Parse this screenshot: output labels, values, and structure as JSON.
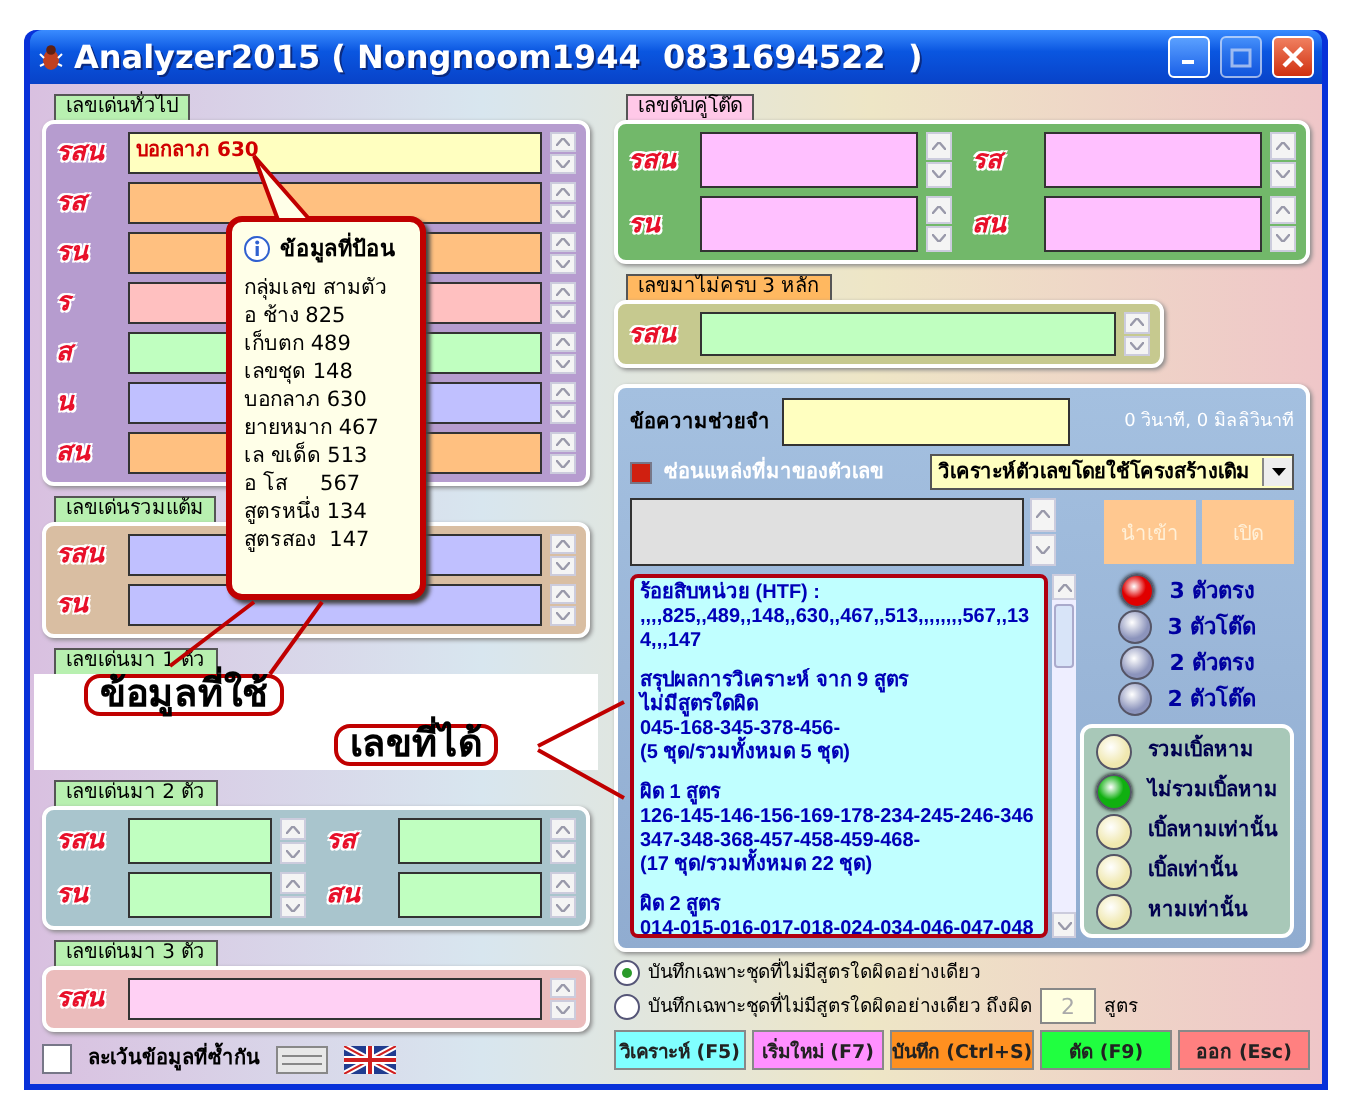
{
  "window": {
    "title": "Analyzer2015 ( Nongnoom1944  0831694522  )"
  },
  "left_groups": [
    {
      "tab": "เลขเด่นทั่วไป",
      "kind": "rows",
      "color": "#b69ccf",
      "rows": [
        {
          "label": "รสน",
          "value": "บอกลาภ 630",
          "color": "#ffffc0"
        },
        {
          "label": "รส",
          "color": "#ffc080"
        },
        {
          "label": "รน",
          "color": "#ffc080"
        },
        {
          "label": "ร",
          "color": "#ffc0c0"
        },
        {
          "label": "ส",
          "color": "#c0ffc0"
        },
        {
          "label": "น",
          "color": "#c0c0ff"
        },
        {
          "label": "สน",
          "color": "#ffc080"
        }
      ]
    },
    {
      "tab": "เลขเด่นรวมแต้ม",
      "kind": "rows",
      "color": "#d9bea2",
      "rows": [
        {
          "label": "รสน",
          "color": "#c0c0ff"
        },
        {
          "label": "รน",
          "color": "#c0c0ff"
        }
      ]
    },
    {
      "tab": "เลขเด่นมา 1 ตัว",
      "kind": "covered"
    },
    {
      "tab": "เลขเด่นมา 2 ตัว",
      "kind": "grid",
      "color": "#a9c5cd",
      "rows": [
        {
          "label": "รสน",
          "color": "#c0ffc0"
        },
        {
          "label": "รส",
          "color": "#c0ffc0"
        },
        {
          "label": "รน",
          "color": "#c0ffc0"
        },
        {
          "label": "สน",
          "color": "#c0ffc0"
        }
      ]
    },
    {
      "tab": "เลขเด่นมา 3 ตัว",
      "kind": "rows",
      "color": "#ebbcbc",
      "rows": [
        {
          "label": "รสน",
          "color": "#ffd0f4"
        }
      ]
    }
  ],
  "skip_duplicates": {
    "label": "ละเว้นข้อมูลที่ซ้ำกัน",
    "checked": false
  },
  "right_groups": [
    {
      "tab": "เลขดับคู่โต๊ด",
      "kind": "grid",
      "color": "#72b86a",
      "rows": [
        {
          "label": "รสน",
          "color": "#ffc0ff"
        },
        {
          "label": "รส",
          "color": "#ffc0ff"
        },
        {
          "label": "รน",
          "color": "#ffc0ff"
        },
        {
          "label": "สน",
          "color": "#ffc0ff"
        }
      ]
    },
    {
      "tab": "เลขมาไม่ครบ 3 หลัก",
      "kind": "rows",
      "color": "#c6c98f",
      "rows": [
        {
          "label": "รสน",
          "color": "#c0ffc0"
        }
      ]
    }
  ],
  "memo": {
    "label": "ข้อความช่วยจำ",
    "timing": "0 วินาที, 0 มิลลิวินาที"
  },
  "hide_source": {
    "label": "ซ่อนแหล่งที่มาของตัวเลข",
    "checked": true
  },
  "mode": {
    "value": "วิเคราะห์ตัวเลขโดยใช้โครงสร้างเดิม"
  },
  "import_buttons": [
    {
      "label": "นำเข้า",
      "disabled": true
    },
    {
      "label": "เปิด",
      "disabled": true
    }
  ],
  "results": [
    [
      "ร้อยสิบหน่วย (HTF) :",
      ",,,,825,,489,,148,,630,,467,,513,,,,,,,,567,,134,,,147"
    ],
    [
      "สรุปผลการวิเคราะห์ จาก 9 สูตร",
      "ไม่มีสูตรใดผิด",
      "045-168-345-378-456-",
      "(5 ชุด/รวมทั้งหมด 5 ชุด)"
    ],
    [
      "ผิด 1 สูตร",
      "126-145-146-156-169-178-234-245-246-346",
      "347-348-368-457-458-459-468-",
      "(17 ชุด/รวมทั้งหมด 22 ชุด)"
    ],
    [
      "ผิด 2 สูตร",
      "014-015-016-017-018-024-034-046-047-048"
    ]
  ],
  "digit_modes": [
    {
      "label": "3 ตัวตรง",
      "on": true,
      "color": "#e00000"
    },
    {
      "label": "3 ตัวโต๊ด",
      "on": false,
      "color": "#8c94bc"
    },
    {
      "label": "2 ตัวตรง",
      "on": false,
      "color": "#8c94bc"
    },
    {
      "label": "2 ตัวโต๊ด",
      "on": false,
      "color": "#8c94bc"
    }
  ],
  "double_modes": [
    {
      "label": "รวมเบิ้ลหาม",
      "on": false,
      "color": "#f0e8b0"
    },
    {
      "label": "ไม่รวมเบิ้ลหาม",
      "on": true,
      "color": "#10b010"
    },
    {
      "label": "เบิ้ลหามเท่านั้น",
      "on": false,
      "color": "#f0e8b0"
    },
    {
      "label": "เบิ้ลเท่านั้น",
      "on": false,
      "color": "#f0e8b0"
    },
    {
      "label": "หามเท่านั้น",
      "on": false,
      "color": "#f0e8b0"
    }
  ],
  "save_options": [
    {
      "label": "บันทึกเฉพาะชุดที่ไม่มีสูตรใดผิดอย่างเดียว",
      "selected": true
    },
    {
      "label": "บันทึกเฉพาะชุดที่ไม่มีสูตรใดผิดอย่างเดียว ถึงผิด",
      "selected": false,
      "count": "2",
      "suffix": "สูตร"
    }
  ],
  "actions": [
    {
      "label": "วิเคราะห์ (F5)",
      "color": "#80ffff"
    },
    {
      "label": "เริ่มใหม่ (F7)",
      "color": "#ff90ff"
    },
    {
      "label": "บันทึก (Ctrl+S)",
      "color": "#ff9020"
    },
    {
      "label": "ตัด (F9)",
      "color": "#20ff40"
    },
    {
      "label": "ออก (Esc)",
      "color": "#ff8080"
    }
  ],
  "tooltip": {
    "title": "ข้อมูลที่ป้อน",
    "lines": [
      "กลุ่มเลข สามตัว",
      "อ ช้าง 825",
      "เก็บตก 489",
      "เลขชุด 148",
      "บอกลาภ 630",
      "ยายหมาก 467",
      "เล ขเด็ด 513",
      "อ โส     567",
      "สูตรหนึ่ง 134",
      "สูตรสอง  147"
    ]
  },
  "callouts": [
    "ข้อมูลที่ใช้",
    "เลขที่ได้"
  ]
}
